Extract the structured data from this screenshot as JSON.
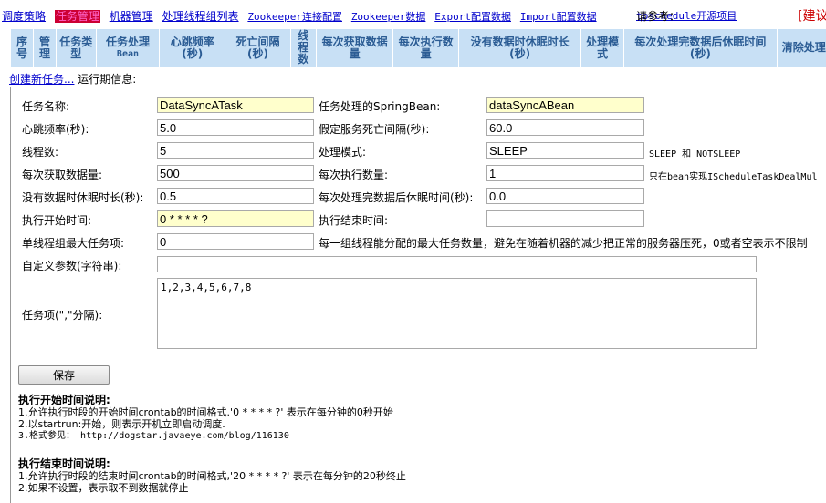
{
  "nav": {
    "items": [
      "调度策略",
      "任务管理",
      "机器管理",
      "处理线程组列表",
      "Zookeeper连接配置",
      "Zookeeper数据",
      "Export配置数据",
      "Import配置数据"
    ],
    "ref_label": "请参考：",
    "ref_link": "tbschedule开源项目",
    "suggest": "[建议"
  },
  "header": {
    "columns": [
      {
        "label": "序号"
      },
      {
        "label": "管理"
      },
      {
        "label": "任务类型"
      },
      {
        "label": "任务处理",
        "sub": "Bean"
      },
      {
        "label": "心跳频率(秒)"
      },
      {
        "label": "死亡间隔(秒)"
      },
      {
        "label": "线程数"
      },
      {
        "label": "每次获取数据量"
      },
      {
        "label": "每次执行数量"
      },
      {
        "label": "没有数据时休眠时长(秒)"
      },
      {
        "label": "处理模式"
      },
      {
        "label": "每次处理完数据后休眠时间(秒)"
      },
      {
        "label": "清除处理"
      }
    ]
  },
  "info": {
    "create_link": "创建新任务...",
    "runtime": "运行期信息:"
  },
  "form": {
    "task_name_label": "任务名称:",
    "task_name": "DataSyncATask",
    "bean_label": "任务处理的SpringBean:",
    "bean": "dataSyncABean",
    "heartbeat_label": "心跳频率(秒):",
    "heartbeat": "5.0",
    "dead_label": "假定服务死亡间隔(秒):",
    "dead": "60.0",
    "threads_label": "线程数:",
    "threads": "5",
    "mode_label": "处理模式:",
    "mode": "SLEEP",
    "mode_hint": "SLEEP 和 NOTSLEEP",
    "fetch_label": "每次获取数据量:",
    "fetch": "500",
    "exec_label": "每次执行数量:",
    "exec": "1",
    "exec_hint": "只在bean实现IScheduleTaskDealMul",
    "idle_label": "没有数据时休眠时长(秒):",
    "idle": "0.5",
    "after_label": "每次处理完数据后休眠时间(秒):",
    "after": "0.0",
    "start_label": "执行开始时间:",
    "start": "0 * * * * ?",
    "end_label": "执行结束时间:",
    "end": "",
    "max_items_label": "单线程组最大任务项:",
    "max_items": "0",
    "max_items_hint": "每一组线程能分配的最大任务数量，避免在随着机器的减少把正常的服务器压死，0或者空表示不限制",
    "params_label": "自定义参数(字符串):",
    "params": "",
    "items_label": "任务项(\",\"分隔):",
    "items": "1,2,3,4,5,6,7,8",
    "save": "保存"
  },
  "notes": {
    "start_title": "执行开始时间说明:",
    "start_1": "1.允许执行时段的开始时间crontab的时间格式.'0 * * * * ?' 表示在每分钟的0秒开始",
    "start_2": "2.以startrun:开始，则表示开机立即启动调度.",
    "start_3": "3.格式参见： http://dogstar.javaeye.com/blog/116130",
    "end_title": "执行结束时间说明:",
    "end_1": "1.允许执行时段的结束时间crontab的时间格式,'20 * * * * ?' 表示在每分钟的20秒终止",
    "end_2": "2.如果不设置，表示取不到数据就停止"
  }
}
